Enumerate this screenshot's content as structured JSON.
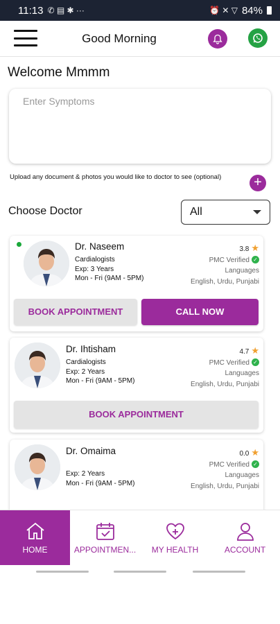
{
  "status_bar": {
    "time": "11:13",
    "battery": "84%",
    "left_icons": "✆ ▤ ✱  ···",
    "right_icons": "⏰ ✕ ▽"
  },
  "header": {
    "title": "Good Morning",
    "menu_icon": "menu-icon",
    "bell_icon": "bell-icon",
    "whatsapp_icon": "whatsapp-icon",
    "brand_color": "#9b2b9c"
  },
  "welcome": "Welcome Mmmm",
  "symptoms": {
    "placeholder": "Enter Symptoms",
    "value": ""
  },
  "upload": {
    "text": "Upload any document & photos you would like to doctor to see (optional)",
    "button": "+"
  },
  "choose_doctor": {
    "label": "Choose Doctor",
    "selected": "All"
  },
  "doctors": [
    {
      "name": "Dr. Naseem",
      "specialty": "Cardialogists",
      "experience": "Exp: 3 Years",
      "timing": "Mon - Fri (9AM - 5PM)",
      "rating": "3.8",
      "verified": "PMC Verified",
      "languages_label": "Languages",
      "languages": "English, Urdu, Punjabi",
      "online": true,
      "book_label": "BOOK APPOINTMENT",
      "call_label": "CALL NOW"
    },
    {
      "name": "Dr. Ihtisham",
      "specialty": "Cardialogists",
      "experience": "Exp: 2 Years",
      "timing": "Mon - Fri (9AM - 5PM)",
      "rating": "4.7",
      "verified": "PMC Verified",
      "languages_label": "Languages",
      "languages": "English, Urdu, Punjabi",
      "book_label": "BOOK APPOINTMENT"
    },
    {
      "name": "Dr. Omaima",
      "specialty": "",
      "experience": "Exp: 2 Years",
      "timing": "Mon - Fri (9AM - 5PM)",
      "rating": "0.0",
      "verified": "PMC Verified",
      "languages_label": "Languages",
      "languages": "English, Urdu, Punjabi"
    }
  ],
  "bottom_nav": [
    {
      "label": "HOME",
      "icon": "home-icon",
      "active": true
    },
    {
      "label": "APPOINTMEN...",
      "icon": "calendar-check-icon",
      "active": false
    },
    {
      "label": "MY HEALTH",
      "icon": "heart-plus-icon",
      "active": false
    },
    {
      "label": "ACCOUNT",
      "icon": "person-icon",
      "active": false
    }
  ]
}
